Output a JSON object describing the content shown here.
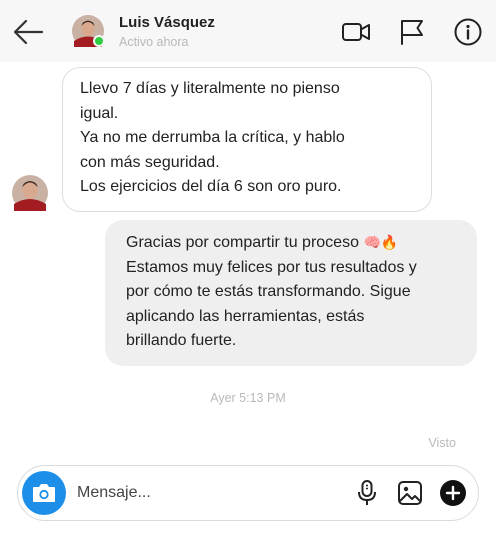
{
  "header": {
    "contact_name": "Luis Vásquez",
    "status": "Activo ahora",
    "online_color": "#2ecc40",
    "icons": [
      "back-arrow-icon",
      "video-camera-icon",
      "flag-icon",
      "info-icon"
    ]
  },
  "messages": {
    "incoming": {
      "lines": [
        "Llevo 7 días y literalmente no pienso",
        "igual.",
        "Ya no me derrumba la crítica, y hablo",
        "con más seguridad.",
        "Los ejercicios del día 6 son oro puro."
      ]
    },
    "outgoing": {
      "lines": [
        "Gracias por compartir tu proceso",
        "Estamos muy felices por tus resultados y",
        "por cómo te estás transformando. Sigue",
        "aplicando las herramientas, estás",
        "brillando fuerte."
      ],
      "emojis": [
        "🧠",
        "🔥"
      ]
    },
    "timestamp": "Ayer 5:13 PM",
    "seen_label": "Visto"
  },
  "composer": {
    "placeholder": "Mensaje...",
    "camera_color": "#1d8fe9",
    "icons": [
      "camera-icon",
      "microphone-icon",
      "gallery-icon",
      "plus-icon"
    ]
  }
}
